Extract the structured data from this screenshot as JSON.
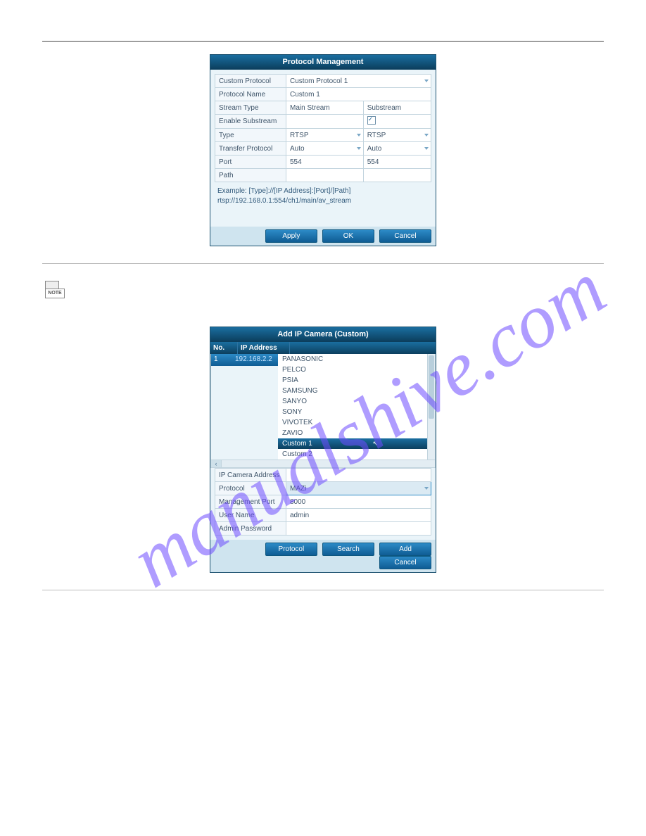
{
  "watermark_text": "manualshive.com",
  "note_icon_label": "NOTE",
  "protocol_dialog": {
    "title": "Protocol Management",
    "rows": {
      "custom_protocol_label": "Custom Protocol",
      "custom_protocol_value": "Custom Protocol 1",
      "protocol_name_label": "Protocol Name",
      "protocol_name_value": "Custom 1",
      "stream_type_label": "Stream Type",
      "main_stream": "Main Stream",
      "substream": "Substream",
      "enable_substream_label": "Enable Substream",
      "type_label": "Type",
      "type_main": "RTSP",
      "type_sub": "RTSP",
      "transfer_protocol_label": "Transfer Protocol",
      "transfer_main": "Auto",
      "transfer_sub": "Auto",
      "port_label": "Port",
      "port_main": "554",
      "port_sub": "554",
      "path_label": "Path"
    },
    "example_line1": "Example: [Type]://[IP Address]:[Port]/[Path]",
    "example_line2": "rtsp://192.168.0.1:554/ch1/main/av_stream",
    "buttons": {
      "apply": "Apply",
      "ok": "OK",
      "cancel": "Cancel"
    }
  },
  "add_ip_dialog": {
    "title": "Add IP Camera (Custom)",
    "columns": {
      "no": "No.",
      "ip": "IP Address"
    },
    "row1": {
      "no": "1",
      "ip": "192.168.2.2"
    },
    "options": [
      "PANASONIC",
      "PELCO",
      "PSIA",
      "SAMSUNG",
      "SANYO",
      "SONY",
      "VIVOTEK",
      "ZAVIO",
      "Custom 1",
      "Custom 2"
    ],
    "selected_option": "Custom 1",
    "fields": {
      "ip_address_label": "IP Camera Address",
      "protocol_label": "Protocol",
      "protocol_value": "MAZi",
      "mgmt_port_label": "Management Port",
      "mgmt_port_value": "8000",
      "user_name_label": "User Name",
      "user_name_value": "admin",
      "admin_password_label": "Admin Password"
    },
    "buttons": {
      "protocol": "Protocol",
      "search": "Search",
      "add": "Add",
      "cancel": "Cancel"
    }
  }
}
